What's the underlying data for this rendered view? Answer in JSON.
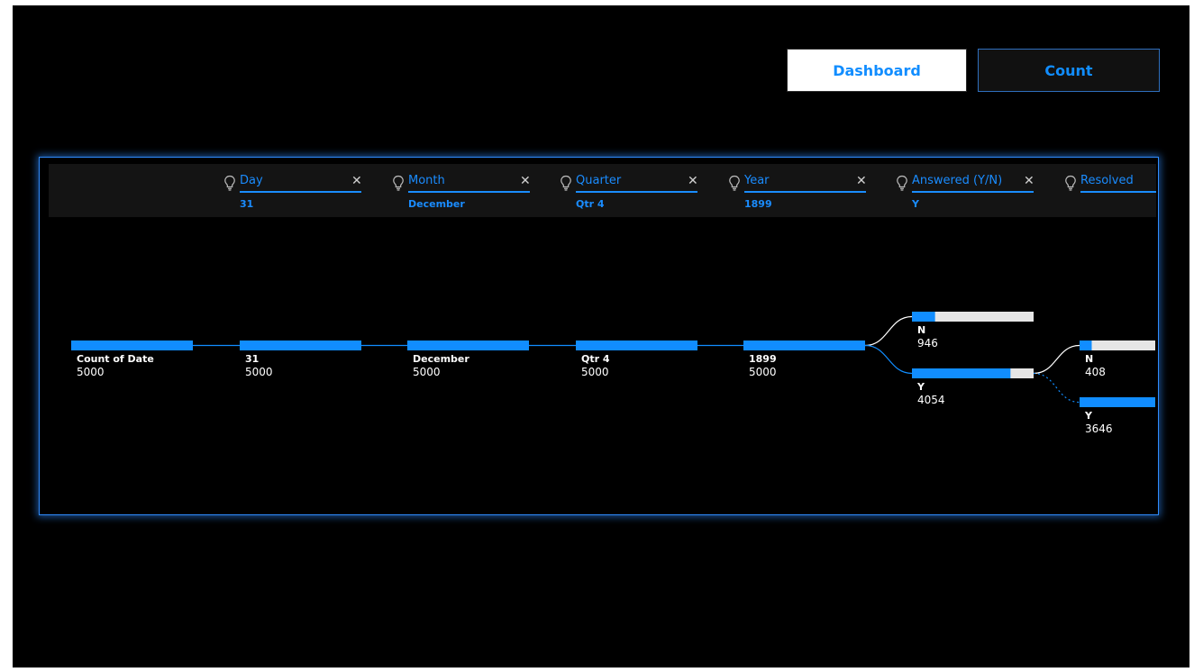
{
  "nav": {
    "dashboard_label": "Dashboard",
    "count_label": "Count"
  },
  "colors": {
    "accent": "#118dff",
    "bar_track": "#e6e6e6",
    "background": "#000000"
  },
  "levels": [
    {
      "title": "Day",
      "value": "31",
      "icon": "lightbulb-icon",
      "closable": true
    },
    {
      "title": "Month",
      "value": "December",
      "icon": "lightbulb-icon",
      "closable": true
    },
    {
      "title": "Quarter",
      "value": "Qtr 4",
      "icon": "lightbulb-icon",
      "closable": true
    },
    {
      "title": "Year",
      "value": "1899",
      "icon": "lightbulb-icon",
      "closable": true
    },
    {
      "title": "Answered (Y/N)",
      "value": "Y",
      "icon": "lightbulb-icon",
      "closable": true
    },
    {
      "title": "Resolved",
      "value": "",
      "icon": "lightbulb-icon",
      "closable": false
    }
  ],
  "chart_data": {
    "type": "decomposition-tree",
    "root": {
      "label": "Count of Date",
      "value": 5000
    },
    "nodes": [
      {
        "id": "root",
        "label": "Count of Date",
        "value": 5000,
        "level": 0,
        "fraction": 1.0
      },
      {
        "id": "day",
        "label": "31",
        "value": 5000,
        "level": 1,
        "parent": "root",
        "fraction": 1.0
      },
      {
        "id": "month",
        "label": "December",
        "value": 5000,
        "level": 2,
        "parent": "day",
        "fraction": 1.0
      },
      {
        "id": "quarter",
        "label": "Qtr 4",
        "value": 5000,
        "level": 3,
        "parent": "month",
        "fraction": 1.0
      },
      {
        "id": "year",
        "label": "1899",
        "value": 5000,
        "level": 4,
        "parent": "quarter",
        "fraction": 1.0
      },
      {
        "id": "answered-n",
        "label": "N",
        "value": 946,
        "level": 5,
        "parent": "year",
        "fraction": 0.19,
        "selected": false
      },
      {
        "id": "answered-y",
        "label": "Y",
        "value": 4054,
        "level": 5,
        "parent": "year",
        "fraction": 0.81,
        "selected": true
      },
      {
        "id": "resolved-n",
        "label": "N",
        "value": 408,
        "level": 6,
        "parent": "answered-y",
        "fraction": 0.1,
        "selected": false
      },
      {
        "id": "resolved-y",
        "label": "Y",
        "value": 3646,
        "level": 6,
        "parent": "answered-y",
        "fraction": 0.9,
        "selected": false,
        "dotted_link": true
      }
    ]
  }
}
